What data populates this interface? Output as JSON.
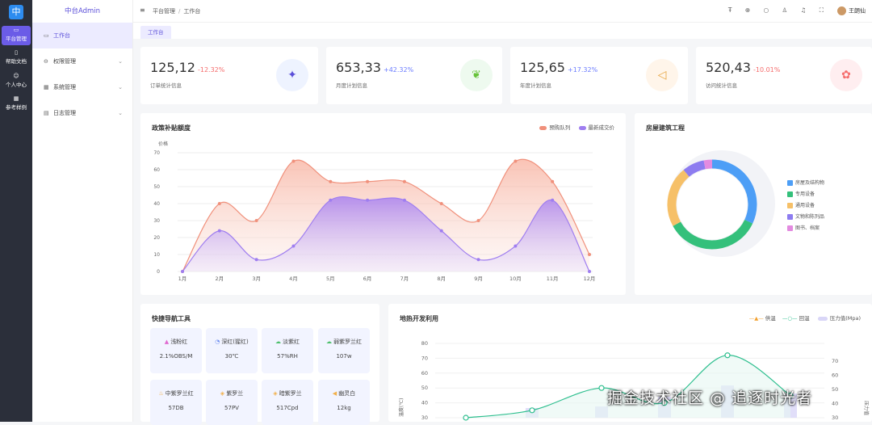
{
  "rail": {
    "logo": "中",
    "items": [
      {
        "icon": "▭",
        "label": "平台管理"
      },
      {
        "icon": "▯",
        "label": "帮助文档"
      },
      {
        "icon": "☺",
        "label": "个人中心"
      },
      {
        "icon": "▦",
        "label": "参考样例"
      }
    ]
  },
  "sidebar": {
    "brand": "中台Admin",
    "items": [
      {
        "icon": "▭",
        "label": "工作台"
      },
      {
        "icon": "⊖",
        "label": "权限管理",
        "chev": "⌄"
      },
      {
        "icon": "▦",
        "label": "系统管理",
        "chev": "⌄"
      },
      {
        "icon": "▤",
        "label": "日志管理",
        "chev": "⌄"
      }
    ]
  },
  "header": {
    "menu_icon": "≡",
    "breadcrumb": [
      "平台管理",
      "工作台"
    ],
    "sep": "/",
    "user": "王朗仙",
    "tools": [
      "Ŧ",
      "⊕",
      "○",
      "♙",
      "♫",
      "⛶"
    ]
  },
  "tabs": [
    {
      "label": "工作台"
    }
  ],
  "stats": [
    {
      "value": "125,12",
      "change": "-12.32%",
      "label": "订单统计信息",
      "trend_color": "#f56c6c",
      "icon_bg": "#eef3ff",
      "icon_color": "#5b4fd9"
    },
    {
      "value": "653,33",
      "change": "+42.32%",
      "label": "月度计划信息",
      "trend_color": "#6b7cff",
      "icon_bg": "#eefaef",
      "icon_color": "#67c23a"
    },
    {
      "value": "125,65",
      "change": "+17.32%",
      "label": "年度计划信息",
      "trend_color": "#6b7cff",
      "icon_bg": "#fff5ea",
      "icon_color": "#e6a23c"
    },
    {
      "value": "520,43",
      "change": "-10.01%",
      "label": "访问统计信息",
      "trend_color": "#f56c6c",
      "icon_bg": "#ffeef0",
      "icon_color": "#f56c6c"
    }
  ],
  "area_card": {
    "title": "政策补贴额度"
  },
  "donut_card": {
    "title": "房屋建筑工程"
  },
  "quick_card": {
    "title": "快捷导航工具",
    "items": [
      {
        "icon": "▲",
        "name": "浅粉红",
        "value": "2.1%OBS/M"
      },
      {
        "icon": "◔",
        "name": "深红(猩红)",
        "value": "30℃"
      },
      {
        "icon": "☁",
        "name": "淡紫红",
        "value": "57%RH"
      },
      {
        "icon": "☁",
        "name": "弱紫罗兰红",
        "value": "107w"
      },
      {
        "icon": "♨",
        "name": "中紫罗兰红",
        "value": "57DB"
      },
      {
        "icon": "◈",
        "name": "紫罗兰",
        "value": "57PV"
      },
      {
        "icon": "◈",
        "name": "暗紫罗兰",
        "value": "517Cpd"
      },
      {
        "icon": "◀",
        "name": "幽灵白",
        "value": "12kg"
      }
    ]
  },
  "heat_card": {
    "title": "地热开发利用"
  },
  "watermark": "掘金技术社区 @ 追逐时光者",
  "chart_data": [
    {
      "type": "area",
      "title": "政策补贴额度",
      "ylabel": "价格",
      "ylim": [
        0,
        70
      ],
      "yticks": [
        0,
        10,
        20,
        30,
        40,
        50,
        60,
        70
      ],
      "categories": [
        "1月",
        "2月",
        "3月",
        "4月",
        "5月",
        "6月",
        "7月",
        "8月",
        "9月",
        "10月",
        "11月",
        "12月"
      ],
      "series": [
        {
          "name": "预购队列",
          "color": "#f0907b",
          "values": [
            0,
            40,
            30,
            65,
            53,
            53,
            53,
            40,
            30,
            65,
            53,
            10
          ]
        },
        {
          "name": "最新成交价",
          "color": "#9f7ef0",
          "values": [
            0,
            24,
            7,
            15,
            42,
            42,
            42,
            24,
            7,
            15,
            42,
            0
          ]
        }
      ],
      "legend": "top-right"
    },
    {
      "type": "pie",
      "title": "房屋建筑工程",
      "slices": [
        {
          "name": "房屋及结构物",
          "color": "#4d9ef6",
          "value": 32
        },
        {
          "name": "专用设备",
          "color": "#34c07b",
          "value": 35
        },
        {
          "name": "通用设备",
          "color": "#f6c068",
          "value": 22
        },
        {
          "name": "文物和陈列品",
          "color": "#8d7cf0",
          "value": 8
        },
        {
          "name": "图书、档案",
          "color": "#e38be0",
          "value": 3
        }
      ],
      "legend": "right"
    },
    {
      "type": "line",
      "title": "地热开发利用",
      "y_left": {
        "ylabel": "温度(℃)",
        "ticks": [
          30,
          40,
          50,
          60,
          70,
          80
        ]
      },
      "y_right": {
        "ylabel": "压力值",
        "ticks": [
          30,
          40,
          50,
          60,
          70
        ]
      },
      "series": [
        {
          "name": "供温",
          "color": "#f29f2c"
        },
        {
          "name": "回温",
          "color": "#2fbf8f",
          "values": [
            30,
            35,
            50,
            40,
            72,
            45
          ]
        },
        {
          "name": "压力值(Mpa)",
          "color": "#d9d6f7"
        }
      ],
      "legend": "top-right"
    }
  ]
}
